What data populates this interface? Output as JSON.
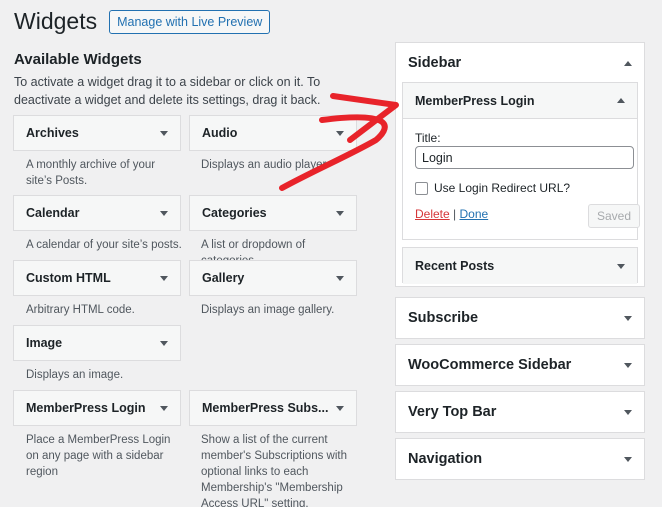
{
  "header": {
    "title": "Widgets",
    "live_preview": "Manage with Live Preview"
  },
  "available": {
    "title": "Available Widgets",
    "description": "To activate a widget drag it to a sidebar or click on it. To deactivate a widget and delete its settings, drag it back.",
    "widgets": [
      {
        "name": "Archives",
        "desc": "A monthly archive of your site’s Posts."
      },
      {
        "name": "Audio",
        "desc": "Displays an audio player."
      },
      {
        "name": "Calendar",
        "desc": "A calendar of your site’s posts."
      },
      {
        "name": "Categories",
        "desc": "A list or dropdown of categories."
      },
      {
        "name": "Custom HTML",
        "desc": "Arbitrary HTML code."
      },
      {
        "name": "Gallery",
        "desc": "Displays an image gallery."
      },
      {
        "name": "Image",
        "desc": "Displays an image."
      },
      {
        "name": "MemberPress Login",
        "desc": "Place a MemberPress Login on any page with a sidebar region"
      },
      {
        "name": "MemberPress Subs...",
        "desc": "Show a list of the current member's Subscriptions with optional links to each Membership's \"Membership Access URL\" setting."
      }
    ]
  },
  "sidebar": {
    "title": "Sidebar",
    "widget": {
      "title": "MemberPress Login",
      "title_label": "Title:",
      "title_value": "Login",
      "checkbox_label": "Use Login Redirect URL?",
      "delete": "Delete",
      "separator": "|",
      "done": "Done",
      "saved": "Saved"
    },
    "recent_posts": "Recent Posts"
  },
  "areas": [
    "Subscribe",
    "WooCommerce Sidebar",
    "Very Top Bar",
    "Navigation"
  ],
  "colors": {
    "accent": "#2271b1",
    "delete": "#d63638",
    "annotation_arrow": "#e8232a"
  }
}
